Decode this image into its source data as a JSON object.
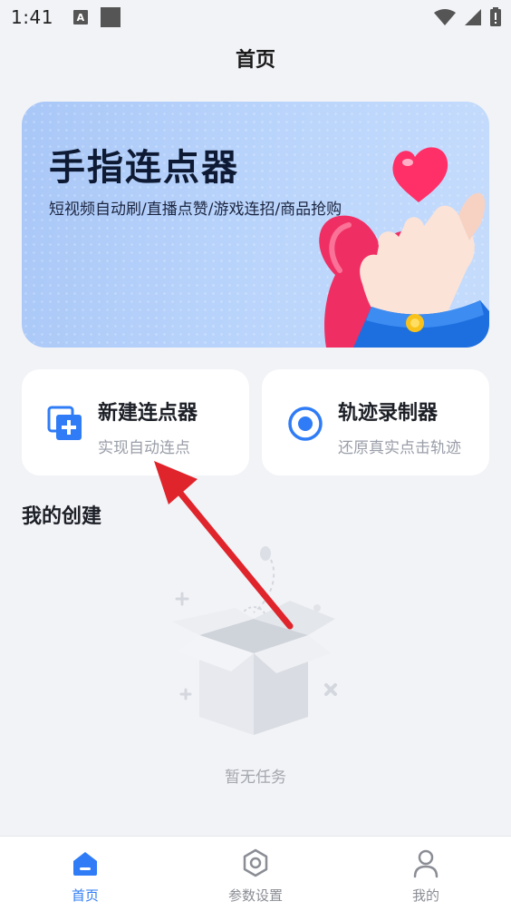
{
  "status_bar": {
    "time": "1:41",
    "notification_letter": "A"
  },
  "header": {
    "title": "首页"
  },
  "banner": {
    "title": "手指连点器",
    "subtitle": "短视频自动刷/直播点赞/游戏连招/商品抢购"
  },
  "actions": [
    {
      "title": "新建连点器",
      "description": "实现自动连点",
      "icon": "add-copy-icon"
    },
    {
      "title": "轨迹录制器",
      "description": "还原真实点击轨迹",
      "icon": "record-target-icon"
    }
  ],
  "section": {
    "title": "我的创建",
    "empty_text": "暂无任务"
  },
  "bottom_nav": {
    "items": [
      {
        "label": "首页",
        "icon": "home-icon",
        "active": true
      },
      {
        "label": "参数设置",
        "icon": "hexagon-settings-icon",
        "active": false
      },
      {
        "label": "我的",
        "icon": "profile-icon",
        "active": false
      }
    ]
  },
  "colors": {
    "accent": "#2f7cf6",
    "background": "#f2f3f7",
    "arrow": "#e0242b"
  }
}
